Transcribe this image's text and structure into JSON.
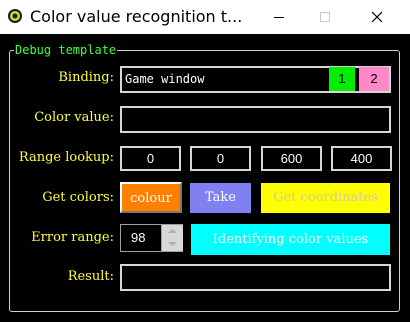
{
  "window": {
    "title": "Color value recognition t...",
    "icon": "app-icon",
    "controls": [
      "minimize-icon",
      "maximize-icon",
      "close-icon"
    ]
  },
  "group": {
    "title": "Debug template"
  },
  "labels": {
    "binding": "Binding:",
    "color_value": "Color value:",
    "range_lookup": "Range lookup:",
    "get_colors": "Get colors:",
    "error_range": "Error range:",
    "result": "Result:"
  },
  "binding": {
    "value": "Game window",
    "btn1": "1",
    "btn2": "2"
  },
  "color_value": {
    "value": ""
  },
  "range": {
    "x1": "0",
    "y1": "0",
    "x2": "600",
    "y2": "400"
  },
  "buttons": {
    "colour": "colour",
    "take": "Take",
    "get_coordinates": "Get coordinates",
    "identify": "Identifying color values"
  },
  "error_range": {
    "value": "98"
  },
  "result": {
    "value": ""
  },
  "colors": {
    "label": "#ffff40",
    "group_title": "#3cff3c",
    "btn1_bg": "#00ee00",
    "btn2_bg": "#ff88c8",
    "colour_bg": "#ff7f00",
    "take_bg": "#8080f0",
    "get_coordinates_bg": "#ffff00",
    "identify_bg": "#00ffff"
  }
}
